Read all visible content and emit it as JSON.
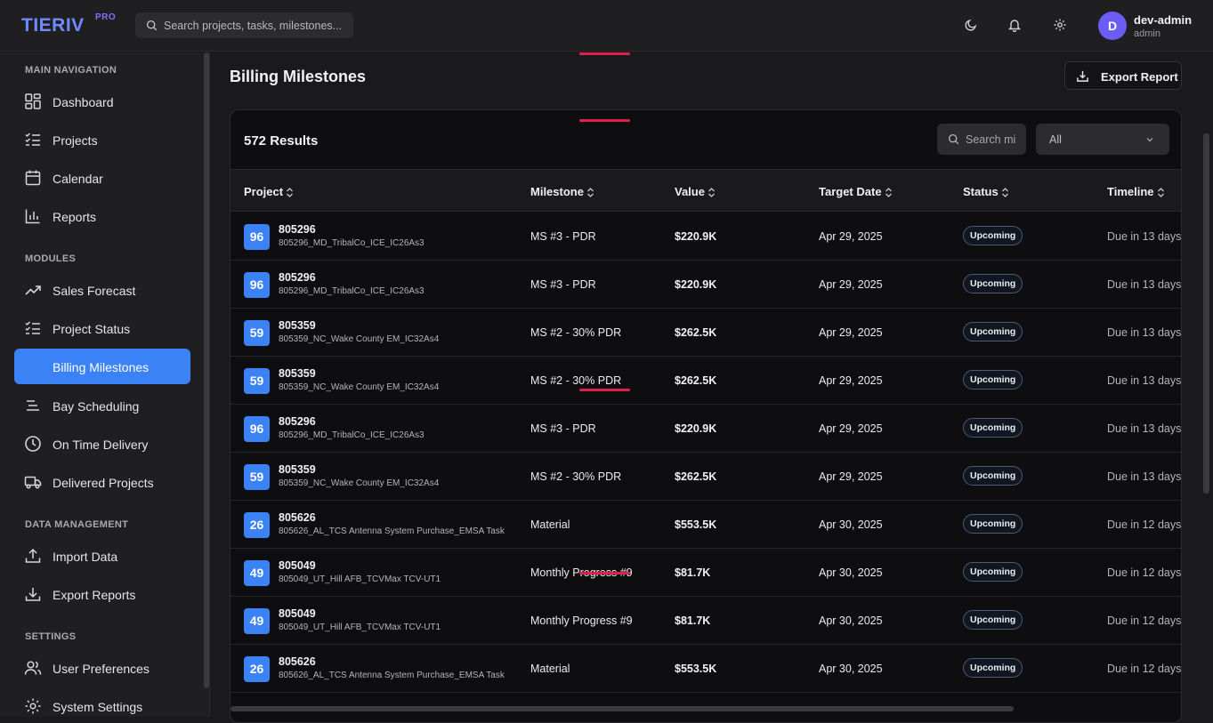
{
  "app": {
    "logo": "TIERIV",
    "logo_badge": "PRO"
  },
  "search": {
    "placeholder": "Search projects, tasks, milestones..."
  },
  "user": {
    "initial": "D",
    "name": "dev-admin",
    "role": "admin"
  },
  "sidebar": {
    "sections": [
      {
        "title": "MAIN NAVIGATION"
      },
      {
        "title": "MODULES"
      },
      {
        "title": "DATA MANAGEMENT"
      },
      {
        "title": "SETTINGS"
      }
    ],
    "items": [
      {
        "label": "Dashboard",
        "icon": "dashboard-icon"
      },
      {
        "label": "Projects",
        "icon": "checklist-icon"
      },
      {
        "label": "Calendar",
        "icon": "calendar-icon"
      },
      {
        "label": "Reports",
        "icon": "bar-chart-icon"
      },
      {
        "label": "Sales Forecast",
        "icon": "trend-up-icon"
      },
      {
        "label": "Project Status",
        "icon": "checklist-icon"
      },
      {
        "label": "Billing Milestones",
        "icon": "receipt-icon",
        "active": true
      },
      {
        "label": "Bay Scheduling",
        "icon": "lines-icon"
      },
      {
        "label": "On Time Delivery",
        "icon": "clock-icon"
      },
      {
        "label": "Delivered Projects",
        "icon": "truck-icon"
      },
      {
        "label": "Import Data",
        "icon": "upload-icon"
      },
      {
        "label": "Export Reports",
        "icon": "download-icon"
      },
      {
        "label": "User Preferences",
        "icon": "users-icon"
      },
      {
        "label": "System Settings",
        "icon": "gear-icon"
      }
    ]
  },
  "page": {
    "title": "Billing Milestones",
    "export_label": "Export Report"
  },
  "table": {
    "results": "572 Results",
    "search_placeholder": "Search mi",
    "filter_value": "All",
    "columns": [
      "Project",
      "Milestone",
      "Value",
      "Target Date",
      "Status",
      "Timeline"
    ],
    "rows": [
      {
        "badge": "96",
        "id": "805296",
        "name": "805296_MD_TribalCo_ICE_IC26As3",
        "milestone": "MS #3 - PDR",
        "value": "$220.9K",
        "date": "Apr 29, 2025",
        "status": "Upcoming",
        "timeline": "Due in 13 days"
      },
      {
        "badge": "96",
        "id": "805296",
        "name": "805296_MD_TribalCo_ICE_IC26As3",
        "milestone": "MS #3 - PDR",
        "value": "$220.9K",
        "date": "Apr 29, 2025",
        "status": "Upcoming",
        "timeline": "Due in 13 days"
      },
      {
        "badge": "59",
        "id": "805359",
        "name": "805359_NC_Wake County EM_IC32As4",
        "milestone": "MS #2 - 30% PDR",
        "value": "$262.5K",
        "date": "Apr 29, 2025",
        "status": "Upcoming",
        "timeline": "Due in 13 days"
      },
      {
        "badge": "59",
        "id": "805359",
        "name": "805359_NC_Wake County EM_IC32As4",
        "milestone": "MS #2 - 30% PDR",
        "value": "$262.5K",
        "date": "Apr 29, 2025",
        "status": "Upcoming",
        "timeline": "Due in 13 days"
      },
      {
        "badge": "96",
        "id": "805296",
        "name": "805296_MD_TribalCo_ICE_IC26As3",
        "milestone": "MS #3 - PDR",
        "value": "$220.9K",
        "date": "Apr 29, 2025",
        "status": "Upcoming",
        "timeline": "Due in 13 days"
      },
      {
        "badge": "59",
        "id": "805359",
        "name": "805359_NC_Wake County EM_IC32As4",
        "milestone": "MS #2 - 30% PDR",
        "value": "$262.5K",
        "date": "Apr 29, 2025",
        "status": "Upcoming",
        "timeline": "Due in 13 days"
      },
      {
        "badge": "26",
        "id": "805626",
        "name": "805626_AL_TCS Antenna System Purchase_EMSA Task",
        "milestone": "Material",
        "value": "$553.5K",
        "date": "Apr 30, 2025",
        "status": "Upcoming",
        "timeline": "Due in 12 days"
      },
      {
        "badge": "49",
        "id": "805049",
        "name": "805049_UT_Hill AFB_TCVMax TCV-UT1",
        "milestone": "Monthly Progress #9",
        "value": "$81.7K",
        "date": "Apr 30, 2025",
        "status": "Upcoming",
        "timeline": "Due in 12 days"
      },
      {
        "badge": "49",
        "id": "805049",
        "name": "805049_UT_Hill AFB_TCVMax TCV-UT1",
        "milestone": "Monthly Progress #9",
        "value": "$81.7K",
        "date": "Apr 30, 2025",
        "status": "Upcoming",
        "timeline": "Due in 12 days"
      },
      {
        "badge": "26",
        "id": "805626",
        "name": "805626_AL_TCS Antenna System Purchase_EMSA Task",
        "milestone": "Material",
        "value": "$553.5K",
        "date": "Apr 30, 2025",
        "status": "Upcoming",
        "timeline": "Due in 12 days"
      }
    ]
  },
  "colors": {
    "accent": "#3b82f6",
    "highlight": "#e0204a",
    "avatar": "#6a5cf5"
  }
}
